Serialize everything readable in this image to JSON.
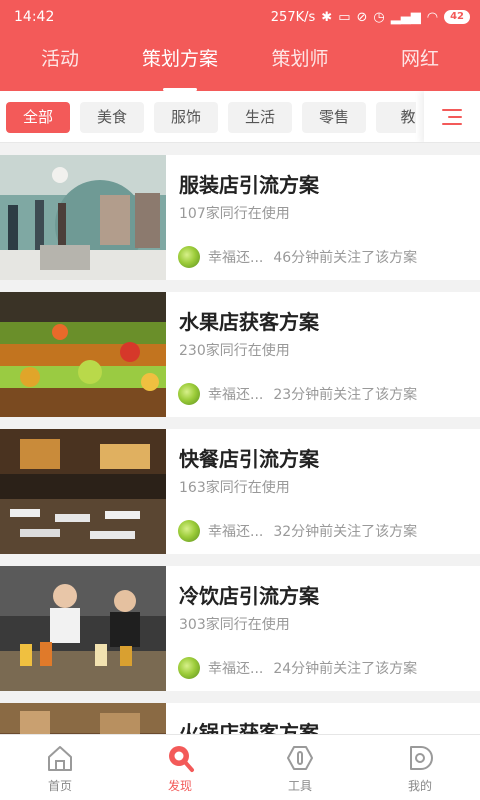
{
  "status": {
    "time": "14:42",
    "speed": "257K/s",
    "battery": "42"
  },
  "tabs": [
    "活动",
    "策划方案",
    "策划师",
    "网红"
  ],
  "filters": [
    "全部",
    "美食",
    "服饰",
    "生活",
    "零售",
    "教"
  ],
  "cards": [
    {
      "title": "服装店引流方案",
      "usage": "107家同行在使用",
      "user": "幸福还...",
      "activity": "46分钟前关注了该方案"
    },
    {
      "title": "水果店获客方案",
      "usage": "230家同行在使用",
      "user": "幸福还...",
      "activity": "23分钟前关注了该方案"
    },
    {
      "title": "快餐店引流方案",
      "usage": "163家同行在使用",
      "user": "幸福还...",
      "activity": "32分钟前关注了该方案"
    },
    {
      "title": "冷饮店引流方案",
      "usage": "303家同行在使用",
      "user": "幸福还...",
      "activity": "24分钟前关注了该方案"
    },
    {
      "title": "火锅店获客方案"
    }
  ],
  "nav": [
    "首页",
    "发现",
    "工具",
    "我的"
  ],
  "colors": {
    "accent": "#f35a59"
  }
}
